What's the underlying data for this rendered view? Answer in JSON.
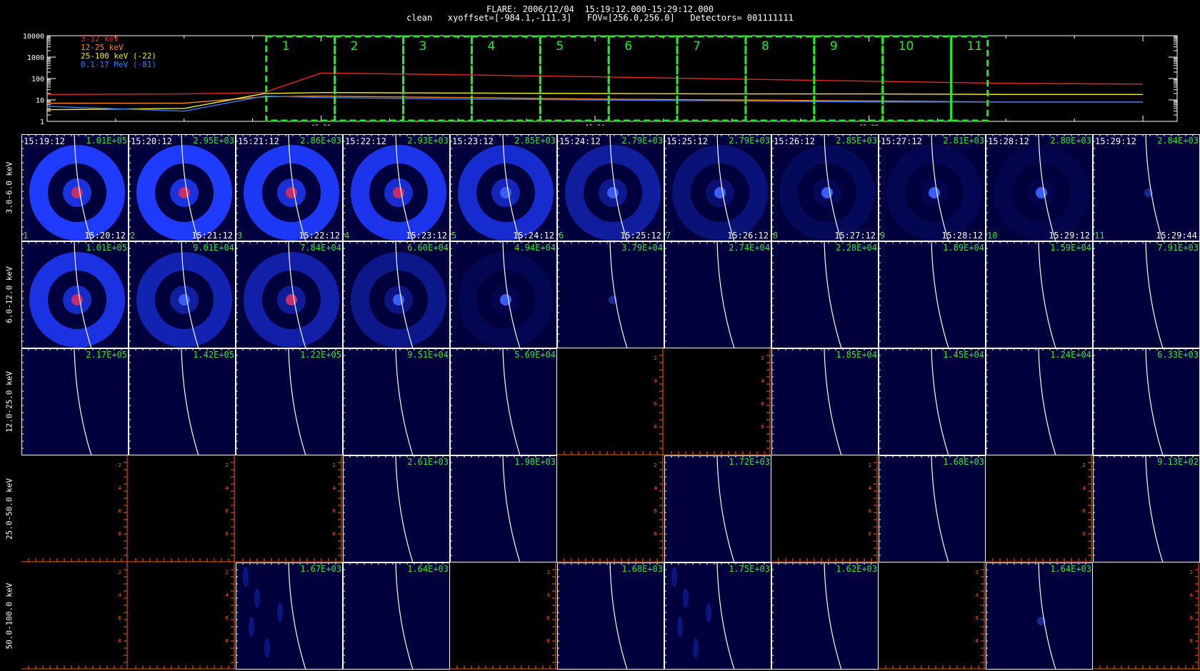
{
  "header": {
    "line1": "FLARE: 2006/12/04  15:19:12.000-15:29:12.000",
    "line2": "clean   xyoffset=[-984.1,-111.3]   FOV=[256.0,256.0]   Detectors= 001111111"
  },
  "lightcurve": {
    "y_tick_labels": [
      "10000",
      "1000",
      "100",
      "10",
      "1"
    ],
    "x_tick_labels": [
      "15:20",
      "15:24",
      "15:28"
    ],
    "legend": [
      {
        "label": "3-12 keV",
        "color": "#e8271f"
      },
      {
        "label": "12-25 keV",
        "color": "#ff8a1a"
      },
      {
        "label": "25-100 keV (-22)",
        "color": "#f2ea1b"
      },
      {
        "label": "0.1-17 MeV (-81)",
        "color": "#2f7bff"
      }
    ],
    "interval_color": "#2ce62c",
    "intervals": [
      "1",
      "2",
      "3",
      "4",
      "5",
      "6",
      "7",
      "8",
      "9",
      "10",
      "11"
    ]
  },
  "chart_data": {
    "type": "line",
    "title": "",
    "xlabel": "",
    "ylabel": "",
    "y_scale": "log",
    "ylim": [
      1,
      10000
    ],
    "x_tick_labels": [
      "15:20",
      "15:24",
      "15:28"
    ],
    "x": [
      "15:16:00",
      "15:18:00",
      "15:19:10",
      "15:20:00",
      "15:22:00",
      "15:24:00",
      "15:26:00",
      "15:28:00",
      "15:30:00",
      "15:32:00"
    ],
    "series": [
      {
        "name": "3-12 keV",
        "color": "#e8271f",
        "values": [
          18,
          19,
          22,
          180,
          150,
          120,
          95,
          75,
          60,
          55
        ]
      },
      {
        "name": "12-25 keV",
        "color": "#ff8a1a",
        "values": [
          7,
          7,
          14,
          15,
          13,
          11,
          10,
          9,
          8,
          8
        ]
      },
      {
        "name": "25-100 keV (-22)",
        "color": "#f2ea1b",
        "values": [
          3.5,
          4,
          20,
          22,
          21,
          20,
          19,
          19,
          18,
          18
        ]
      },
      {
        "name": "0.1-17 MeV (-81)",
        "color": "#2f7bff",
        "values": [
          5,
          3,
          15,
          13,
          11,
          10,
          9,
          8,
          8,
          8
        ]
      }
    ]
  },
  "row_labels": [
    "3.0-6.0 keV",
    "6.0-12.0 keV",
    "12.0-25.0 keV",
    "25.0-50.0 keV",
    "50.0-100.0 keV"
  ],
  "time_labels": [
    "15:19:12",
    "15:20:12",
    "15:21:12",
    "15:22:12",
    "15:23:12",
    "15:24:12",
    "15:25:12",
    "15:26:12",
    "15:27:12",
    "15:28:12",
    "15:29:12"
  ],
  "end_labels": [
    "15:20:12",
    "15:21:12",
    "15:22:12",
    "15:23:12",
    "15:24:12",
    "15:25:12",
    "15:26:12",
    "15:27:12",
    "15:28:12",
    "15:29:12",
    "15:29:44"
  ],
  "index_labels": [
    "1",
    "2",
    "3",
    "4",
    "5",
    "6",
    "7",
    "8",
    "9",
    "10",
    "11"
  ],
  "colors": {
    "image_bg": "#00003d",
    "empty_bg": "#000000",
    "grid_tick": "#ffffff",
    "empty_tick": "#ff5a1a",
    "limb": "#ffffff",
    "ring": "#1f3bff",
    "source_red": "#c0306a",
    "source_blue": "#3a5cff",
    "peak_text": "#3be23b"
  },
  "empty_axis_labels": [
    "2",
    "4",
    "6",
    "8"
  ],
  "cells": [
    [
      {
        "state": "image",
        "peak": "1.01E+05",
        "ring": 1.0,
        "core": "red"
      },
      {
        "state": "image",
        "peak": "2.95E+03",
        "ring": 1.0,
        "core": "red"
      },
      {
        "state": "image",
        "peak": "2.86E+03",
        "ring": 0.95,
        "core": "red"
      },
      {
        "state": "image",
        "peak": "2.93E+03",
        "ring": 0.9,
        "core": "red"
      },
      {
        "state": "image",
        "peak": "2.85E+03",
        "ring": 0.75,
        "core": "blue"
      },
      {
        "state": "image",
        "peak": "2.79E+03",
        "ring": 0.5,
        "core": "blue"
      },
      {
        "state": "image",
        "peak": "2.79E+03",
        "ring": 0.3,
        "core": "blue"
      },
      {
        "state": "image",
        "peak": "2.85E+03",
        "ring": 0.15,
        "core": "blue"
      },
      {
        "state": "image",
        "peak": "2.81E+03",
        "ring": 0.1,
        "core": "blue"
      },
      {
        "state": "image",
        "peak": "2.80E+03",
        "ring": 0.08,
        "core": "blue"
      },
      {
        "state": "image",
        "peak": "2.84E+03",
        "ring": 0.0,
        "core": "faint"
      }
    ],
    [
      {
        "state": "image",
        "peak": "1.01E+05",
        "ring": 0.85,
        "core": "red"
      },
      {
        "state": "image",
        "peak": "9.01E+04",
        "ring": 0.6,
        "core": "blue"
      },
      {
        "state": "image",
        "peak": "7.84E+04",
        "ring": 0.55,
        "core": "red"
      },
      {
        "state": "image",
        "peak": "6.60E+04",
        "ring": 0.4,
        "core": "blue"
      },
      {
        "state": "image",
        "peak": "4.94E+04",
        "ring": 0.1,
        "core": "blue"
      },
      {
        "state": "image",
        "peak": "3.79E+04",
        "ring": 0.0,
        "core": "faint"
      },
      {
        "state": "image",
        "peak": "2.74E+04",
        "ring": 0.0,
        "core": "none"
      },
      {
        "state": "image",
        "peak": "2.28E+04",
        "ring": 0.0,
        "core": "none"
      },
      {
        "state": "image",
        "peak": "1.89E+04",
        "ring": 0.0,
        "core": "none"
      },
      {
        "state": "image",
        "peak": "1.59E+04",
        "ring": 0.0,
        "core": "none"
      },
      {
        "state": "image",
        "peak": "7.91E+03",
        "ring": 0.0,
        "core": "none"
      }
    ],
    [
      {
        "state": "image",
        "peak": "2.17E+05",
        "ring": 0,
        "core": "none"
      },
      {
        "state": "image",
        "peak": "1.42E+05",
        "ring": 0,
        "core": "none"
      },
      {
        "state": "image",
        "peak": "1.22E+05",
        "ring": 0,
        "core": "none"
      },
      {
        "state": "image",
        "peak": "9.51E+04",
        "ring": 0,
        "core": "none"
      },
      {
        "state": "image",
        "peak": "5.69E+04",
        "ring": 0,
        "core": "none"
      },
      {
        "state": "empty",
        "peak": "",
        "ring": 0,
        "core": "none"
      },
      {
        "state": "empty",
        "peak": "",
        "ring": 0,
        "core": "none"
      },
      {
        "state": "image",
        "peak": "1.85E+04",
        "ring": 0,
        "core": "none"
      },
      {
        "state": "image",
        "peak": "1.45E+04",
        "ring": 0,
        "core": "none"
      },
      {
        "state": "image",
        "peak": "1.24E+04",
        "ring": 0,
        "core": "none"
      },
      {
        "state": "image",
        "peak": "6.33E+03",
        "ring": 0,
        "core": "none"
      }
    ],
    [
      {
        "state": "empty",
        "peak": "",
        "ring": 0,
        "core": "none"
      },
      {
        "state": "empty",
        "peak": "",
        "ring": 0,
        "core": "none"
      },
      {
        "state": "empty",
        "peak": "",
        "ring": 0,
        "core": "none"
      },
      {
        "state": "image",
        "peak": "2.61E+03",
        "ring": 0,
        "core": "none"
      },
      {
        "state": "image",
        "peak": "1.98E+03",
        "ring": 0,
        "core": "none"
      },
      {
        "state": "empty",
        "peak": "",
        "ring": 0,
        "core": "none"
      },
      {
        "state": "image",
        "peak": "1.72E+03",
        "ring": 0,
        "core": "none"
      },
      {
        "state": "empty",
        "peak": "",
        "ring": 0,
        "core": "none"
      },
      {
        "state": "image",
        "peak": "1.68E+03",
        "ring": 0,
        "core": "none"
      },
      {
        "state": "empty",
        "peak": "",
        "ring": 0,
        "core": "none"
      },
      {
        "state": "image",
        "peak": "9.13E+02",
        "ring": 0,
        "core": "none"
      }
    ],
    [
      {
        "state": "empty",
        "peak": "",
        "ring": 0,
        "core": "none"
      },
      {
        "state": "empty",
        "peak": "",
        "ring": 0,
        "core": "none"
      },
      {
        "state": "image",
        "peak": "1.67E+03",
        "ring": 0,
        "core": "noise"
      },
      {
        "state": "image",
        "peak": "1.64E+03",
        "ring": 0,
        "core": "none"
      },
      {
        "state": "empty",
        "peak": "",
        "ring": 0,
        "core": "none"
      },
      {
        "state": "image",
        "peak": "1.68E+03",
        "ring": 0,
        "core": "none"
      },
      {
        "state": "image",
        "peak": "1.75E+03",
        "ring": 0,
        "core": "noise"
      },
      {
        "state": "image",
        "peak": "1.62E+03",
        "ring": 0,
        "core": "none"
      },
      {
        "state": "empty",
        "peak": "",
        "ring": 0,
        "core": "none"
      },
      {
        "state": "image",
        "peak": "1.64E+03",
        "ring": 0,
        "core": "faint"
      },
      {
        "state": "empty",
        "peak": "",
        "ring": 0,
        "core": "none"
      }
    ]
  ]
}
